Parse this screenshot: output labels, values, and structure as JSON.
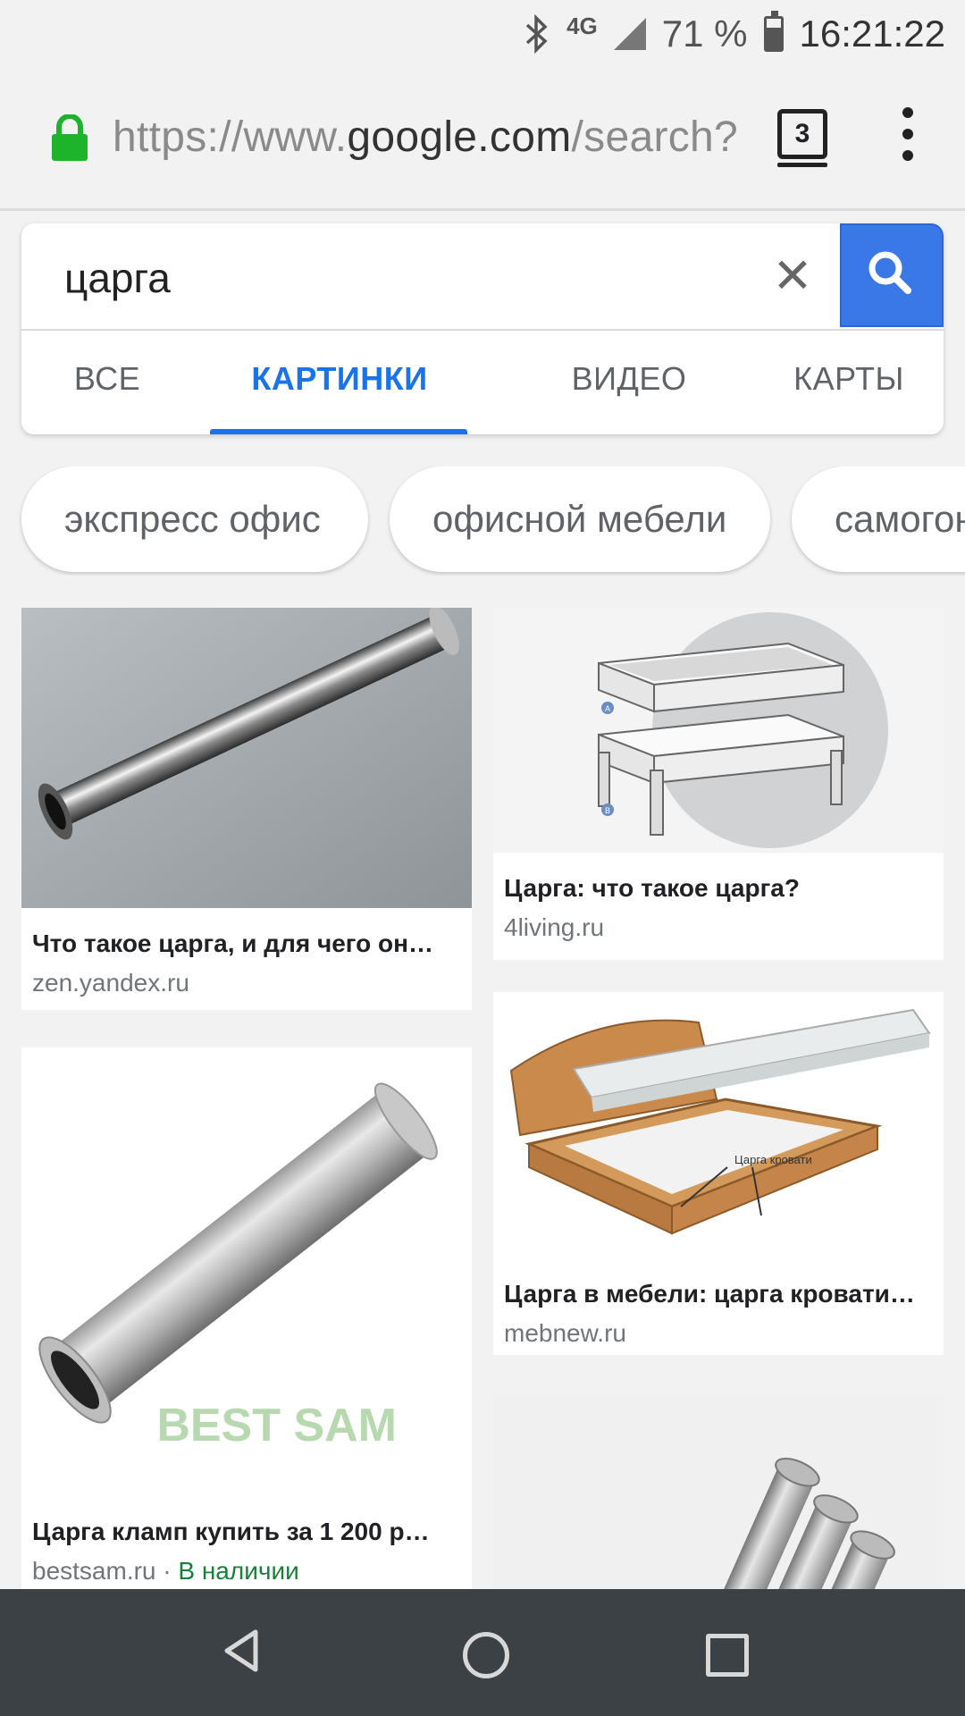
{
  "status_bar": {
    "network": "4G",
    "battery": "71 %",
    "battery_level": 0.71,
    "time": "16:21:22"
  },
  "browser": {
    "url_prefix": "https://www.",
    "url_domain": "google.com",
    "url_suffix": "/search?",
    "tab_count": "3"
  },
  "search": {
    "query": "царга",
    "tabs": [
      {
        "label": "ВСЕ",
        "active": false
      },
      {
        "label": "КАРТИНКИ",
        "active": true
      },
      {
        "label": "ВИДЕО",
        "active": false
      },
      {
        "label": "КАРТЫ",
        "active": false
      }
    ]
  },
  "chips": [
    "экспресс офис",
    "офисной мебели",
    "самогон"
  ],
  "results": [
    {
      "title": "Что такое царга, и для чего он…",
      "source": "zen.yandex.ru",
      "availability": ""
    },
    {
      "title": "Царга: что такое царга?",
      "source": "4living.ru",
      "availability": ""
    },
    {
      "title": "Царга кламп купить за 1 200 р…",
      "source": "bestsam.ru",
      "availability": "В наличии"
    },
    {
      "title": "Царга в мебели: царга кровати…",
      "source": "mebnew.ru",
      "availability": ""
    },
    {
      "title": "",
      "source": "",
      "availability": ""
    }
  ],
  "image_labels": {
    "frame_marker_a": "A",
    "frame_marker_b": "B",
    "bed_label": "Царга кровати",
    "watermark": "BEST SAM"
  },
  "colors": {
    "accent": "#1a73e8",
    "search_button": "#3b78e7",
    "lock": "#1db32a",
    "available": "#188038",
    "navbar": "#3c4146"
  }
}
